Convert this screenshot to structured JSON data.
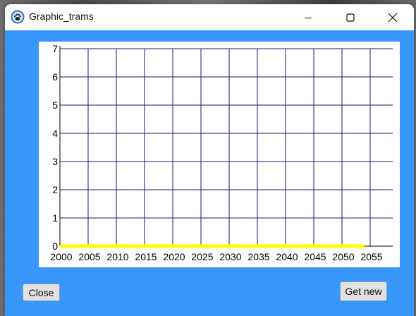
{
  "window": {
    "title": "Graphic_trams",
    "icons": {
      "app": "paw-icon",
      "minimize": "minimize-icon",
      "maximize": "maximize-icon",
      "close": "close-icon"
    }
  },
  "buttons": {
    "close_label": "Close",
    "get_new_label": "Get new"
  },
  "colors": {
    "window_bg": "#3797fb",
    "grid": "#1a1a6e",
    "series": "#ffff00"
  },
  "chart_data": {
    "type": "line",
    "x_ticks": [
      2000,
      2005,
      2010,
      2015,
      2020,
      2025,
      2030,
      2035,
      2040,
      2045,
      2050,
      2055
    ],
    "y_ticks": [
      0,
      1,
      2,
      3,
      4,
      5,
      6,
      7
    ],
    "xlim": [
      2000,
      2059
    ],
    "ylim": [
      0,
      7
    ],
    "grid": true,
    "series": [
      {
        "x": [
          2000,
          2054
        ],
        "y": [
          0,
          0
        ],
        "color": "#ffff00"
      }
    ]
  }
}
